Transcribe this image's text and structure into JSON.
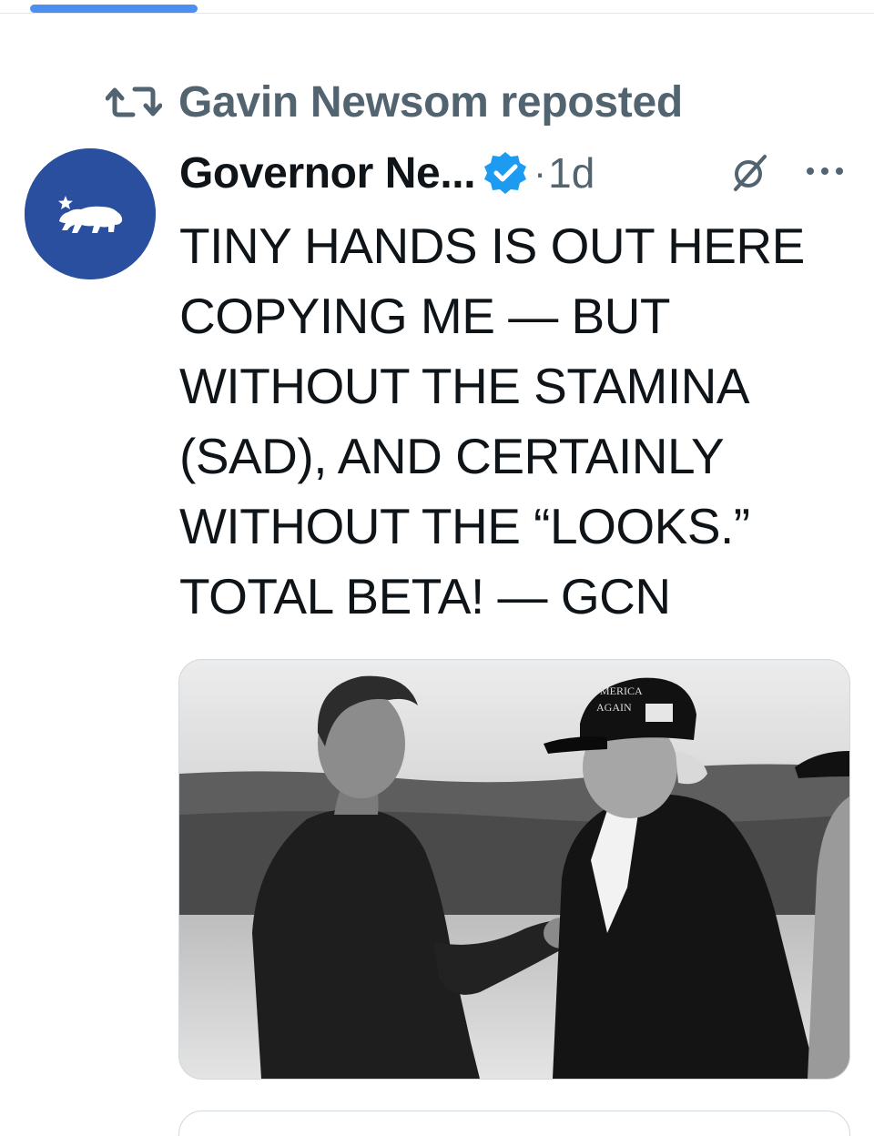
{
  "repost": {
    "text": "Gavin Newsom reposted",
    "icon": "repost-icon"
  },
  "tweet": {
    "author_name": "Governor Ne...",
    "verified": true,
    "separator": "·",
    "time": "1d",
    "body_lines": [
      "TINY HANDS IS OUT HERE",
      "COPYING ME — BUT",
      "WITHOUT THE STAMINA",
      "(SAD), AND CERTAINLY",
      "WITHOUT THE “LOOKS.”",
      "TOTAL BETA! — GCN"
    ],
    "media_hat_text": [
      "MERICA",
      "AGAIN"
    ]
  },
  "colors": {
    "accent": "#1d9bf0",
    "avatar_bg": "#2a4f9e",
    "secondary_text": "#536471",
    "primary_text": "#0f1419",
    "progress": "#4d8ff0"
  }
}
